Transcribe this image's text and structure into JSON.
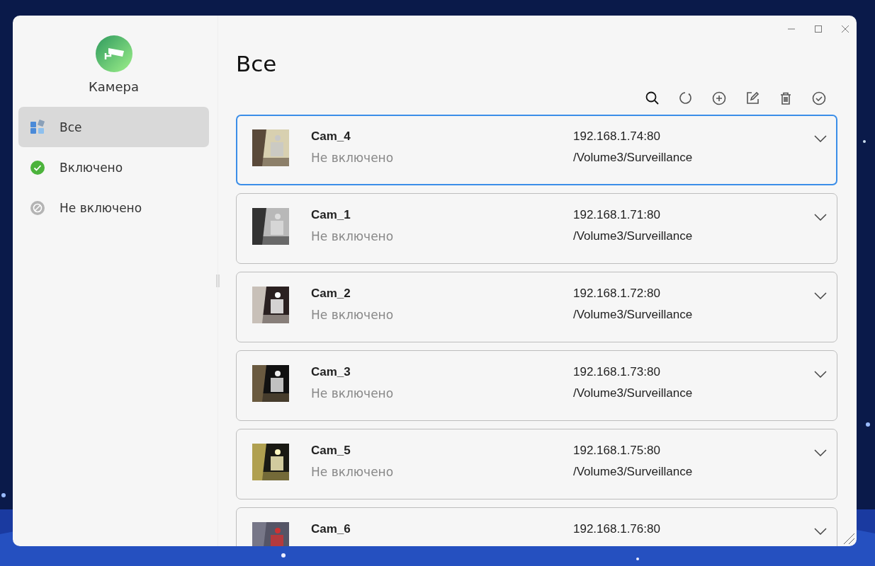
{
  "app": {
    "title": "Камера"
  },
  "sidebar": {
    "items": [
      {
        "label": "Все",
        "kind": "all",
        "selected": true
      },
      {
        "label": "Включено",
        "kind": "enabled",
        "selected": false
      },
      {
        "label": "Не включено",
        "kind": "disabled",
        "selected": false
      }
    ]
  },
  "page": {
    "title": "Все"
  },
  "cameras": [
    {
      "name": "Cam_4",
      "status": "Не включено",
      "address": "192.168.1.74:80",
      "path": "/Volume3/Surveillance",
      "selected": true
    },
    {
      "name": "Cam_1",
      "status": "Не включено",
      "address": "192.168.1.71:80",
      "path": "/Volume3/Surveillance",
      "selected": false
    },
    {
      "name": "Cam_2",
      "status": "Не включено",
      "address": "192.168.1.72:80",
      "path": "/Volume3/Surveillance",
      "selected": false
    },
    {
      "name": "Cam_3",
      "status": "Не включено",
      "address": "192.168.1.73:80",
      "path": "/Volume3/Surveillance",
      "selected": false
    },
    {
      "name": "Cam_5",
      "status": "Не включено",
      "address": "192.168.1.75:80",
      "path": "/Volume3/Surveillance",
      "selected": false
    },
    {
      "name": "Cam_6",
      "address": "192.168.1.76:80",
      "selected": false
    }
  ]
}
